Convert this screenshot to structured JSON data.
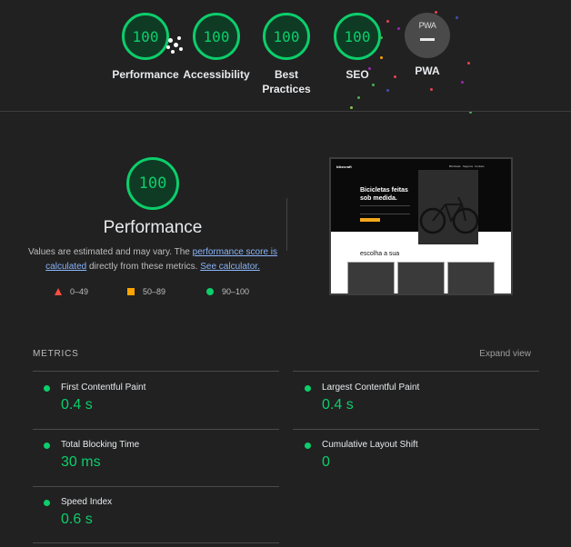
{
  "gauges": [
    {
      "score": "100",
      "label": "Performance"
    },
    {
      "score": "100",
      "label": "Accessibility"
    },
    {
      "score": "100",
      "label_line1": "Best",
      "label_line2": "Practices"
    },
    {
      "score": "100",
      "label": "SEO"
    }
  ],
  "pwa": {
    "badge_text": "PWA",
    "label": "PWA"
  },
  "performance": {
    "score": "100",
    "title": "Performance",
    "desc_prefix": "Values are estimated and may vary. The ",
    "desc_link1": "performance score is calculated",
    "desc_middle": " directly from these metrics. ",
    "desc_link2": "See calculator."
  },
  "legend": {
    "fail": "0–49",
    "average": "50–89",
    "pass": "90–100"
  },
  "screenshot": {
    "logo": "bikecraft",
    "nav": [
      "Bicicletas",
      "Seguros",
      "Contato"
    ],
    "headline_line1": "Bicicletas feitas",
    "headline_line2": "sob medida.",
    "subtitle": "escolha a sua"
  },
  "metrics": {
    "header": "METRICS",
    "expand_label": "Expand view",
    "items": [
      {
        "name": "First Contentful Paint",
        "value": "0.4 s"
      },
      {
        "name": "Largest Contentful Paint",
        "value": "0.4 s"
      },
      {
        "name": "Total Blocking Time",
        "value": "30 ms"
      },
      {
        "name": "Cumulative Layout Shift",
        "value": "0"
      },
      {
        "name": "Speed Index",
        "value": "0.6 s"
      }
    ]
  },
  "colors": {
    "pass": "#0cce6b",
    "average": "#ffa400",
    "fail": "#ff4e42",
    "link": "#8ab4f8"
  }
}
